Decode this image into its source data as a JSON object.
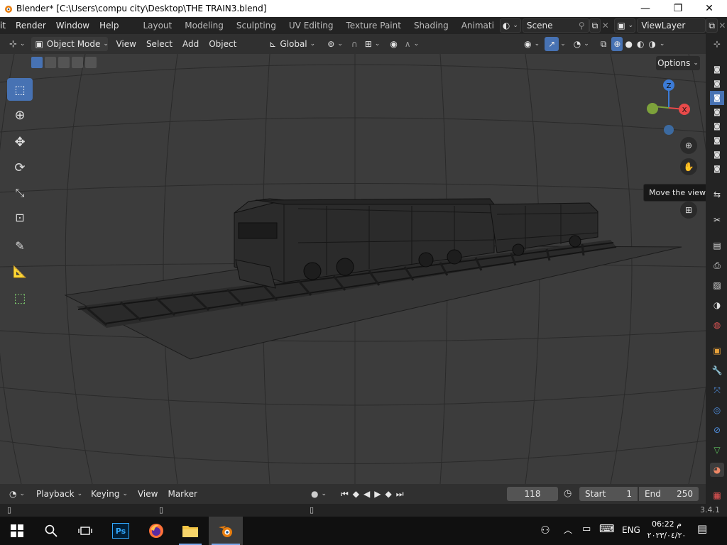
{
  "window": {
    "title": "Blender* [C:\\Users\\compu city\\Desktop\\THE TRAIN3.blend]",
    "min": "—",
    "max": "❐",
    "close": "✕"
  },
  "menu": [
    "it",
    "Render",
    "Window",
    "Help"
  ],
  "workspaces": [
    "Layout",
    "Modeling",
    "Sculpting",
    "UV Editing",
    "Texture Paint",
    "Shading",
    "Animati"
  ],
  "scene": {
    "name": "Scene",
    "view_layer": "ViewLayer"
  },
  "view_header": {
    "mode": "Object Mode",
    "menus": [
      "View",
      "Select",
      "Add",
      "Object"
    ],
    "orientation": "Global"
  },
  "viewport": {
    "options_label": "Options",
    "gizmo": {
      "z": "Z",
      "x": "X"
    },
    "tooltip": "Move the view"
  },
  "timeline": {
    "menus": [
      "Playback",
      "Keying",
      "View",
      "Marker"
    ],
    "current_frame": "118",
    "start_label": "Start",
    "start_value": "1",
    "end_label": "End",
    "end_value": "250"
  },
  "status": {
    "version": "3.4.1"
  },
  "taskbar": {
    "ps_label": "Ps",
    "lang": "ENG",
    "time": "06:22 م",
    "date": "٢٠٢٣/٠٤/٢٠"
  },
  "colors": {
    "accent": "#4772b3",
    "axis_x": "#e94a4a",
    "axis_y": "#7da23b",
    "axis_z": "#3c7bd6",
    "viewport_bg": "#3c3c3c"
  }
}
